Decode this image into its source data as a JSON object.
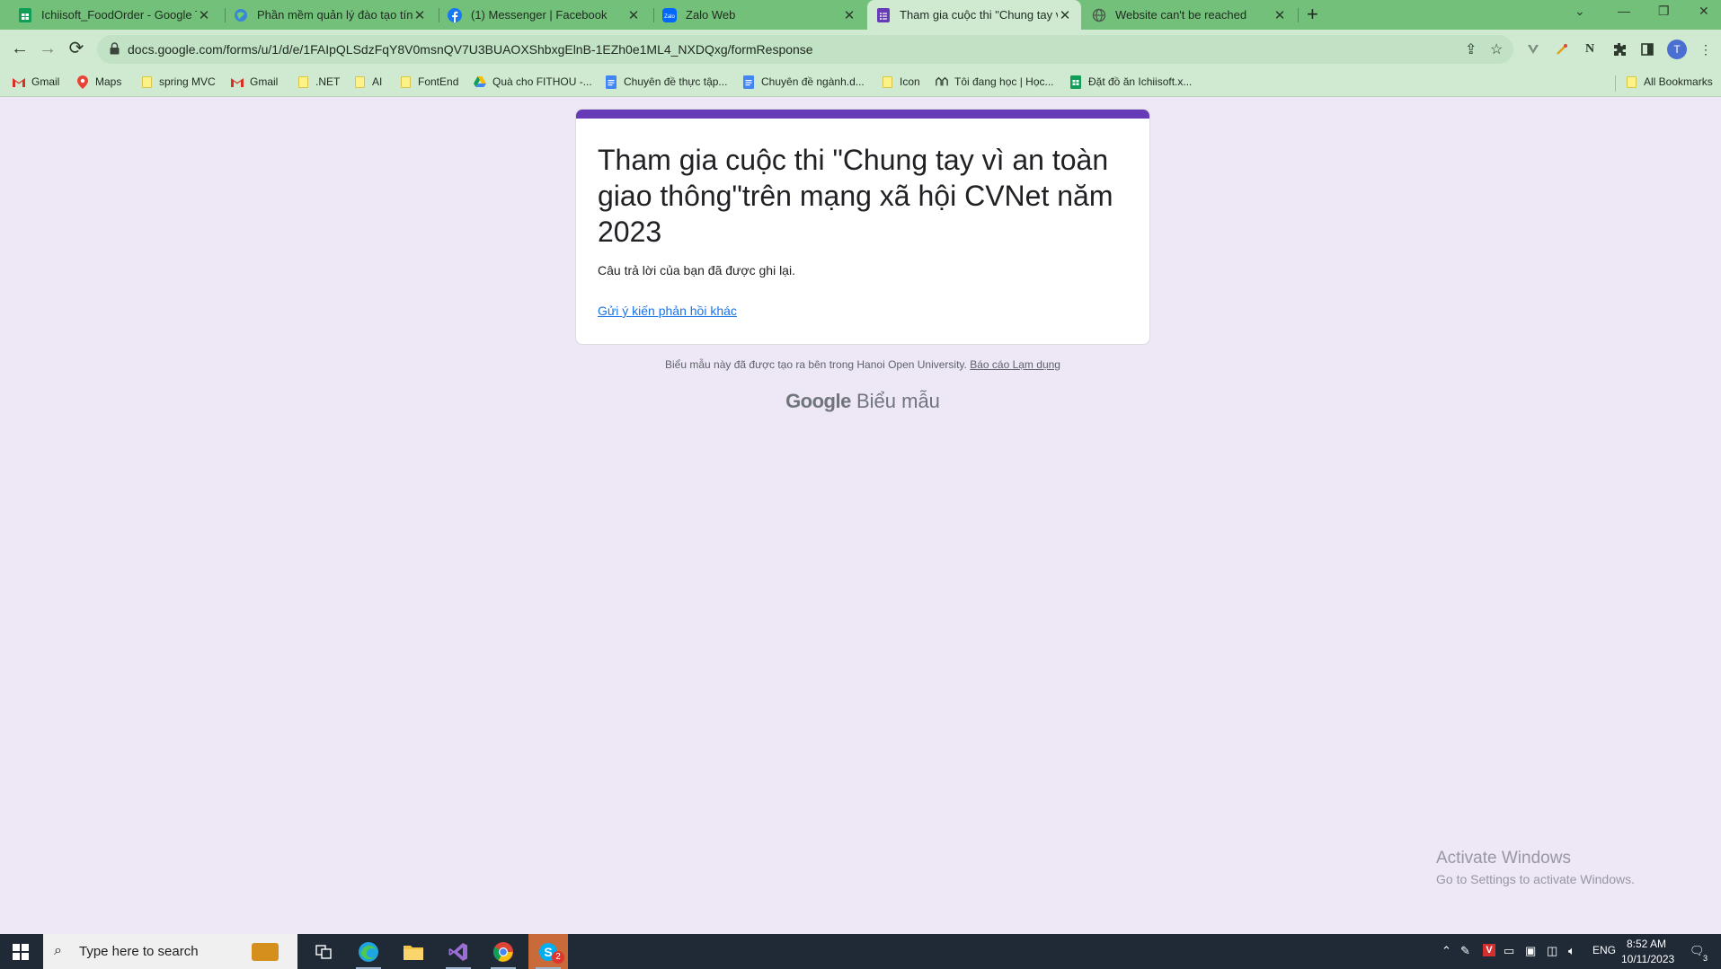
{
  "browser": {
    "tabs": [
      {
        "title": "Ichiisoft_FoodOrder - Google Tr",
        "icon": "sheets-icon",
        "active": false
      },
      {
        "title": "Phần mềm quản lý đào tạo tín c",
        "icon": "globe-blue-icon",
        "active": false
      },
      {
        "title": "(1) Messenger | Facebook",
        "icon": "facebook-icon",
        "active": false
      },
      {
        "title": "Zalo Web",
        "icon": "zalo-icon",
        "active": false
      },
      {
        "title": "Tham gia cuộc thi \"Chung tay vì",
        "icon": "forms-icon",
        "active": true
      },
      {
        "title": "Website can't be reached",
        "icon": "globe-gray-icon",
        "active": false
      }
    ],
    "new_tab_label": "+",
    "close_glyph": "✕",
    "url": "docs.google.com/forms/u/1/d/e/1FAIpQLSdzFqY8V0msnQV7U3BUAOXShbxgElnB-1EZh0e1ML4_NXDQxg/formResponse",
    "profile_initial": "T",
    "bookmarks": [
      {
        "label": "Gmail",
        "icon": "gmail-icon"
      },
      {
        "label": "Maps",
        "icon": "maps-icon"
      },
      {
        "label": "spring MVC",
        "icon": "folder-icon"
      },
      {
        "label": "Gmail",
        "icon": "gmail-icon"
      },
      {
        "label": ".NET",
        "icon": "folder-icon"
      },
      {
        "label": "AI",
        "icon": "folder-icon"
      },
      {
        "label": "FontEnd",
        "icon": "folder-icon"
      },
      {
        "label": "Quà cho FITHOU -...",
        "icon": "drive-icon"
      },
      {
        "label": "Chuyên đề thực tập...",
        "icon": "docs-icon"
      },
      {
        "label": "Chuyên đề ngành.d...",
        "icon": "docs-icon"
      },
      {
        "label": "Icon",
        "icon": "folder-icon"
      },
      {
        "label": "Tôi đang học | Học...",
        "icon": "course-icon"
      },
      {
        "label": "Đặt đồ ăn Ichiisoft.x...",
        "icon": "sheets-icon"
      }
    ],
    "all_bookmarks": "All Bookmarks"
  },
  "form": {
    "title": "Tham gia cuộc thi \"Chung tay vì an toàn giao thông\"trên mạng xã hội CVNet năm 2023",
    "message": "Câu trả lời của bạn đã được ghi lại.",
    "link": "Gửi ý kiến phản hồi khác",
    "footer_text": "Biểu mẫu này đã được tạo ra bên trong Hanoi Open University.",
    "footer_link": "Báo cáo Lạm dụng",
    "brand_google": "Google",
    "brand_forms": "Biểu mẫu",
    "accent_color": "#673ab7"
  },
  "watermark": {
    "line1": "Activate Windows",
    "line2": "Go to Settings to activate Windows."
  },
  "taskbar": {
    "search_placeholder": "Type here to search",
    "language": "ENG",
    "time": "8:52 AM",
    "date": "10/11/2023",
    "notification_count": "3",
    "skype_badge": "2"
  }
}
